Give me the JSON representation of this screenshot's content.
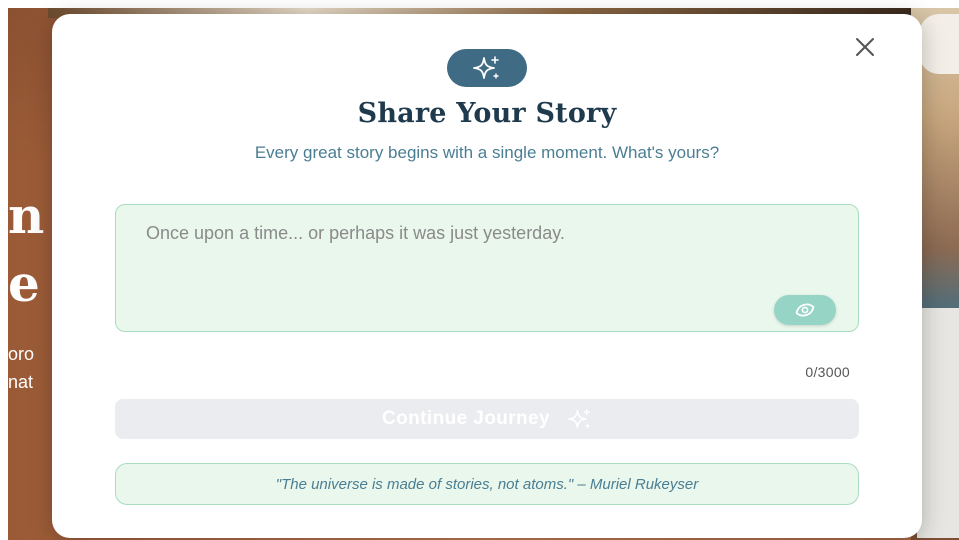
{
  "background": {
    "text_large_1": "n",
    "text_large_2": "e",
    "text_small_1": "oro",
    "text_small_2": "nat"
  },
  "modal": {
    "title": "Share Your Story",
    "subtitle": "Every great story begins with a single moment. What's yours?",
    "story_input": {
      "placeholder": "Once upon a time... or perhaps it was just yesterday.",
      "value": ""
    },
    "char_counter": "0/3000",
    "continue_label": "Continue Journey",
    "quote": "\"The universe is made of stories, not atoms.\" – Muriel Rukeyser",
    "icons": {
      "hero": "sparkles-icon",
      "close": "close-icon",
      "inspire": "eye-icon",
      "continue": "sparkles-icon"
    }
  },
  "colors": {
    "accent": "#3f6b84",
    "title": "#1f3a4d",
    "subtitle": "#4a7e93",
    "input_bg": "#eaf7ec",
    "input_border": "#a9dcc0",
    "button_disabled": "#ebecef",
    "eye_button": "#96d4c6"
  }
}
